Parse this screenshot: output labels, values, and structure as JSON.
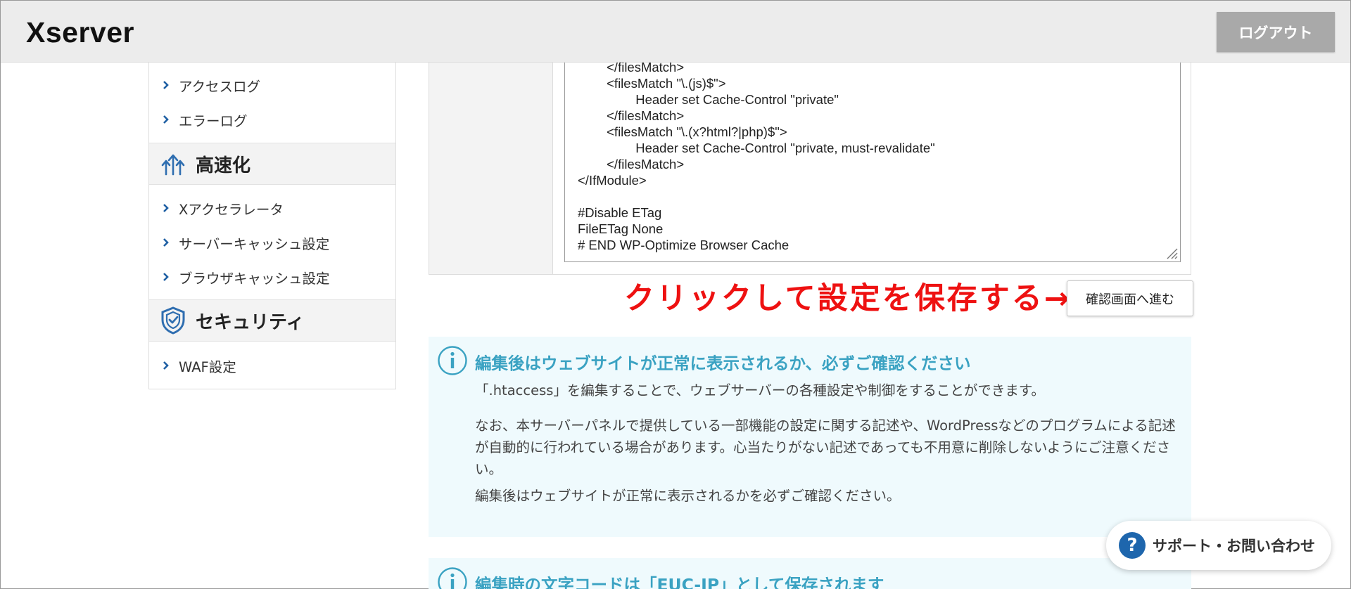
{
  "header": {
    "logo": "Xserver",
    "logout_label": "ログアウト"
  },
  "sidebar": {
    "items_top": [
      {
        "label": "アクセスログ"
      },
      {
        "label": "エラーログ"
      }
    ],
    "section_speed": {
      "title": "高速化",
      "items": [
        {
          "label": "Xアクセラレータ"
        },
        {
          "label": "サーバーキャッシュ設定"
        },
        {
          "label": "ブラウザキャッシュ設定"
        }
      ]
    },
    "section_security": {
      "title": "セキュリティ",
      "items": [
        {
          "label": "WAF設定"
        }
      ]
    }
  },
  "editor": {
    "lines": [
      "        </filesMatch>",
      "        <filesMatch \"\\.(js)$\">",
      "                Header set Cache-Control \"private\"",
      "        </filesMatch>",
      "        <filesMatch \"\\.(x?html?|php)$\">",
      "                Header set Cache-Control \"private, must-revalidate\"",
      "        </filesMatch>",
      "</IfModule>",
      "",
      "#Disable ETag",
      "FileETag None",
      "# END WP-Optimize Browser Cache"
    ]
  },
  "save_row": {
    "annotation": "クリックして設定を保存する→",
    "confirm_label": "確認画面へ進む"
  },
  "notice1": {
    "title": "編集後はウェブサイトが正常に表示されるか、必ずご確認ください",
    "paragraphs": [
      "「.htaccess」を編集することで、ウェブサーバーの各種設定や制御をすることができます。",
      "なお、本サーバーパネルで提供している一部機能の設定に関する記述や、WordPressなどのプログラムによる記述が自動的に行われている場合があります。心当たりがない記述であっても不用意に削除しないようにご注意ください。",
      "編集後はウェブサイトが正常に表示されるかを必ずご確認ください。"
    ]
  },
  "notice2": {
    "title": "編集時の文字コードは「EUC-JP」として保存されます"
  },
  "support": {
    "icon": "?",
    "label": "サポート・お問い合わせ"
  },
  "colors": {
    "accent": "#3aa2c2",
    "annotation": "#ee1111",
    "nav_chevron": "#1e5fa3",
    "support_icon": "#1e66ad"
  }
}
